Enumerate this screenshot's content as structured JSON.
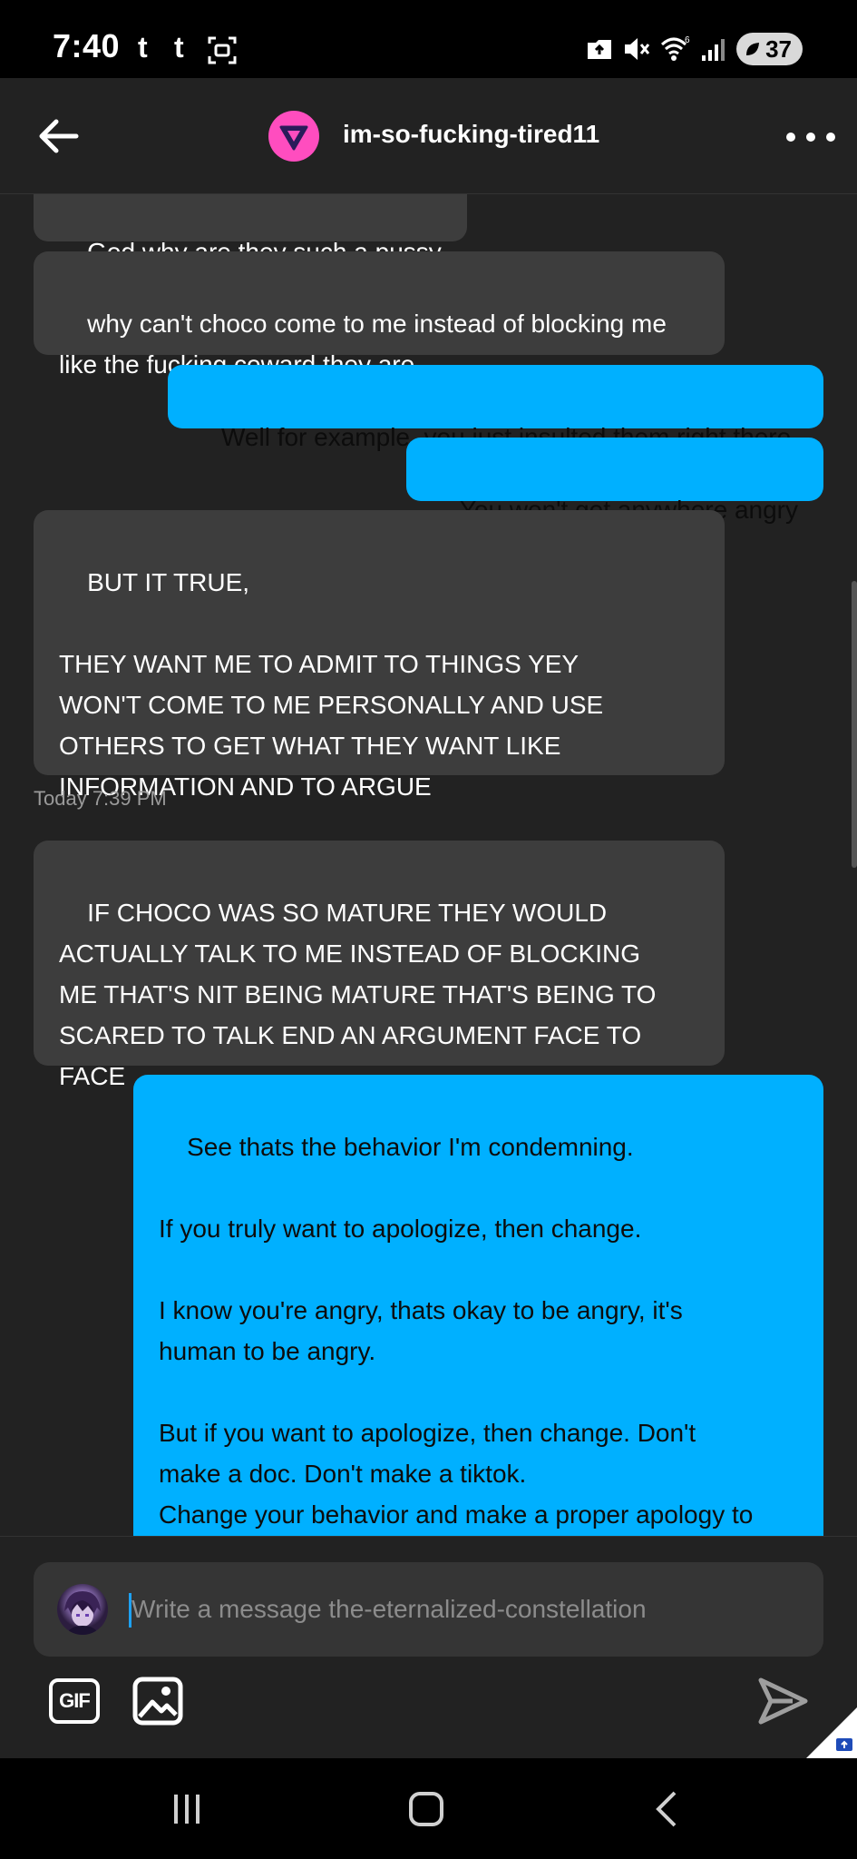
{
  "status_bar": {
    "time": "7:40",
    "app_icons": [
      "t",
      "t"
    ],
    "battery": "37"
  },
  "header": {
    "title": "im-so-fucking-tired11"
  },
  "messages": [
    {
      "direction": "in",
      "text": "God why are they such a pussy"
    },
    {
      "direction": "in",
      "text": "why can't choco come to me instead of blocking me\nlike the fucking coward they are"
    },
    {
      "direction": "out",
      "text": "Well for example, you just insulted them right there."
    },
    {
      "direction": "out",
      "text": "You won't get anywhere angry"
    },
    {
      "direction": "in",
      "text": "BUT IT TRUE,\n\nTHEY WANT ME TO ADMIT TO THINGS YEY\nWON'T COME TO ME PERSONALLY AND USE\nOTHERS TO GET WHAT THEY WANT LIKE\nINFORMATION AND TO ARGUE"
    },
    {
      "direction": "in",
      "text": "IF CHOCO WAS SO MATURE THEY WOULD\nACTUALLY TALK TO ME INSTEAD OF BLOCKING\nME THAT'S NIT BEING MATURE THAT'S BEING TO\nSCARED TO TALK END AN ARGUMENT FACE TO\nFACE"
    },
    {
      "direction": "out",
      "text": "See thats the behavior I'm condemning.\n\nIf you truly want to apologize, then change.\n\nI know you're angry, thats okay to be angry, it's\nhuman to be angry.\n\nBut if you want to apologize, then change. Don't\nmake a doc. Don't make a tiktok.\nChange your behavior and make a proper apology to\neveryone in this situation."
    }
  ],
  "timestamp": "Today 7:39 PM",
  "compose": {
    "placeholder": "Write a message the-eternalized-constellation",
    "gif_label": "GIF"
  },
  "colors": {
    "incoming_bubble": "#3d3d3d",
    "outgoing_bubble": "#00b0ff",
    "background": "#222222",
    "avatar_pink": "#ff4dbf"
  }
}
